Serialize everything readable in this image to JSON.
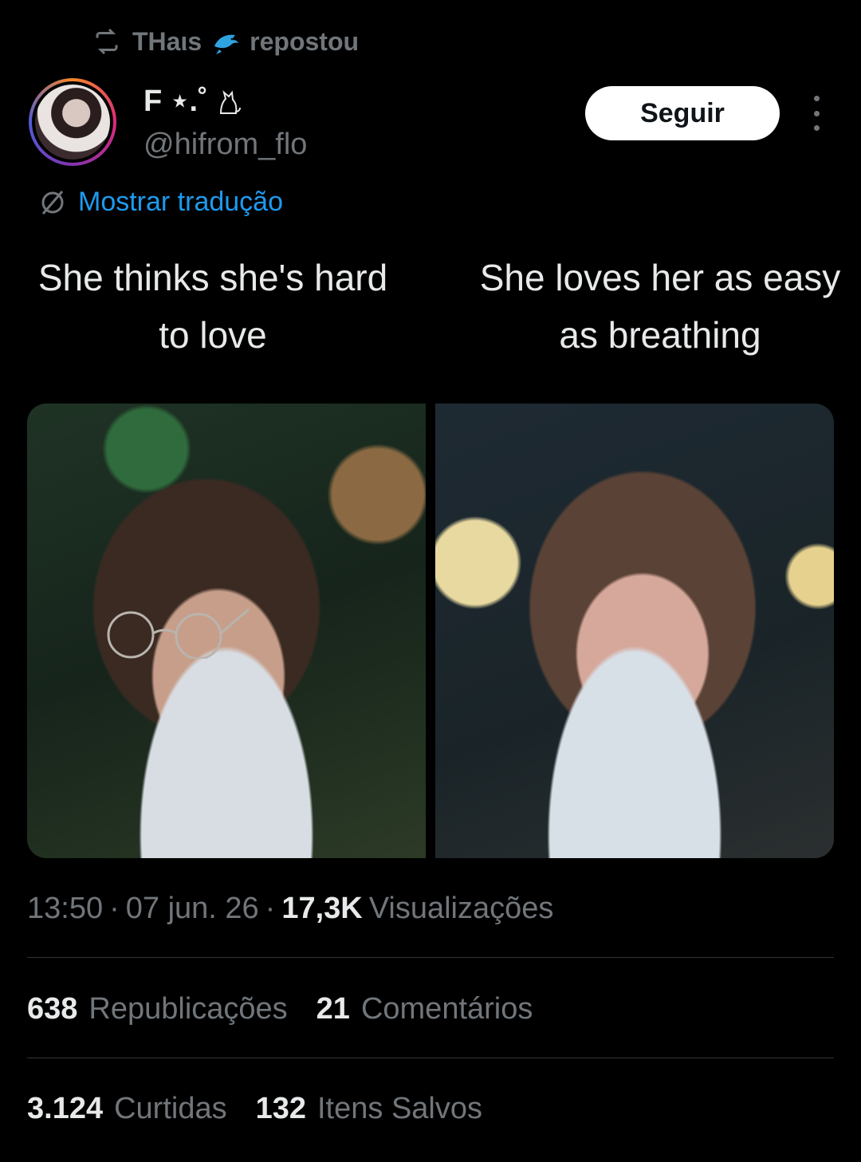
{
  "repost": {
    "reposter_name": "THaιs",
    "label": "repostou"
  },
  "author": {
    "display_name": "F ⋆.˚",
    "handle": "@hifrom_flo"
  },
  "actions": {
    "follow_label": "Seguir",
    "translate_label": "Mostrar tradução"
  },
  "post": {
    "caption_left": "She thinks she's hard to love",
    "caption_right": "She loves her as easy as breathing"
  },
  "meta": {
    "time": "13:50",
    "date": "07 jun. 26",
    "views_count": "17,3K",
    "views_label": "Visualizações"
  },
  "stats": [
    {
      "count": "638",
      "label": "Republicações"
    },
    {
      "count": "21",
      "label": "Comentários"
    },
    {
      "count": "3.124",
      "label": "Curtidas"
    },
    {
      "count": "132",
      "label": "Itens Salvos"
    }
  ],
  "colors": {
    "background": "#000000",
    "text_primary": "#e7e9ea",
    "text_secondary": "#71767b",
    "link": "#1d9bf0",
    "divider": "#2f3336"
  }
}
